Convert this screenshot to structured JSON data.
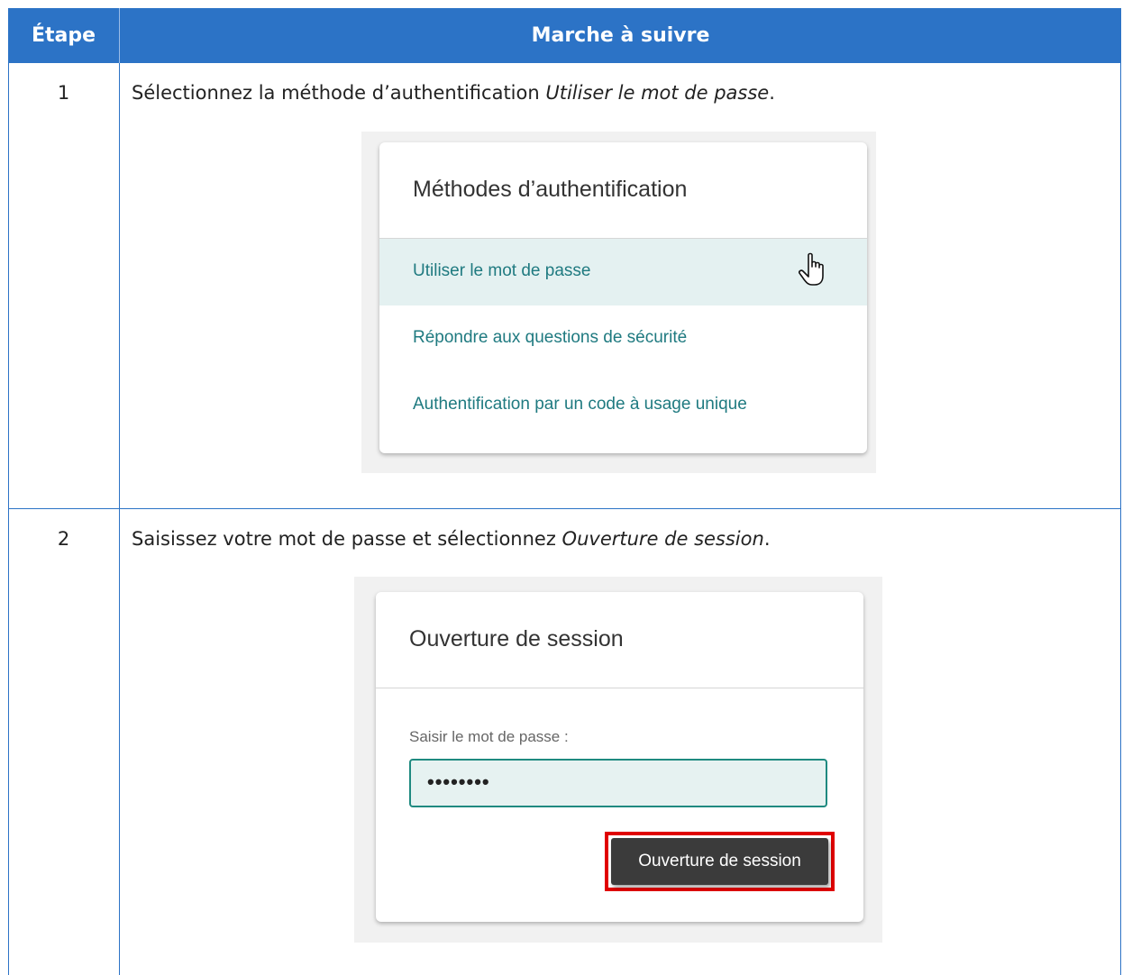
{
  "header": {
    "step": "Étape",
    "procedure": "Marche à suivre"
  },
  "steps": [
    {
      "number": "1",
      "text_before": "Sélectionnez la méthode d’authentification ",
      "text_italic": "Utiliser le mot de passe",
      "text_after": "."
    },
    {
      "number": "2",
      "text_before": "Saisissez votre mot de passe et sélectionnez ",
      "text_italic": "Ouverture de session",
      "text_after": "."
    }
  ],
  "auth_methods_card": {
    "title": "Méthodes d’authentification",
    "items": [
      {
        "label": "Utiliser le mot de passe",
        "highlighted": true
      },
      {
        "label": "Répondre aux questions de sécurité",
        "highlighted": false
      },
      {
        "label": "Authentification par un code à usage unique",
        "highlighted": false
      }
    ],
    "cursor": "hand-pointer-icon"
  },
  "login_card": {
    "title": "Ouverture de session",
    "password_label": "Saisir le mot de passe :",
    "password_value": "••••••••",
    "submit_label": "Ouverture de session",
    "highlight_color": "#e00000"
  },
  "colors": {
    "header_bg": "#2c73c6",
    "link": "#1f7a80",
    "highlight_row": "#e4f1f1"
  }
}
